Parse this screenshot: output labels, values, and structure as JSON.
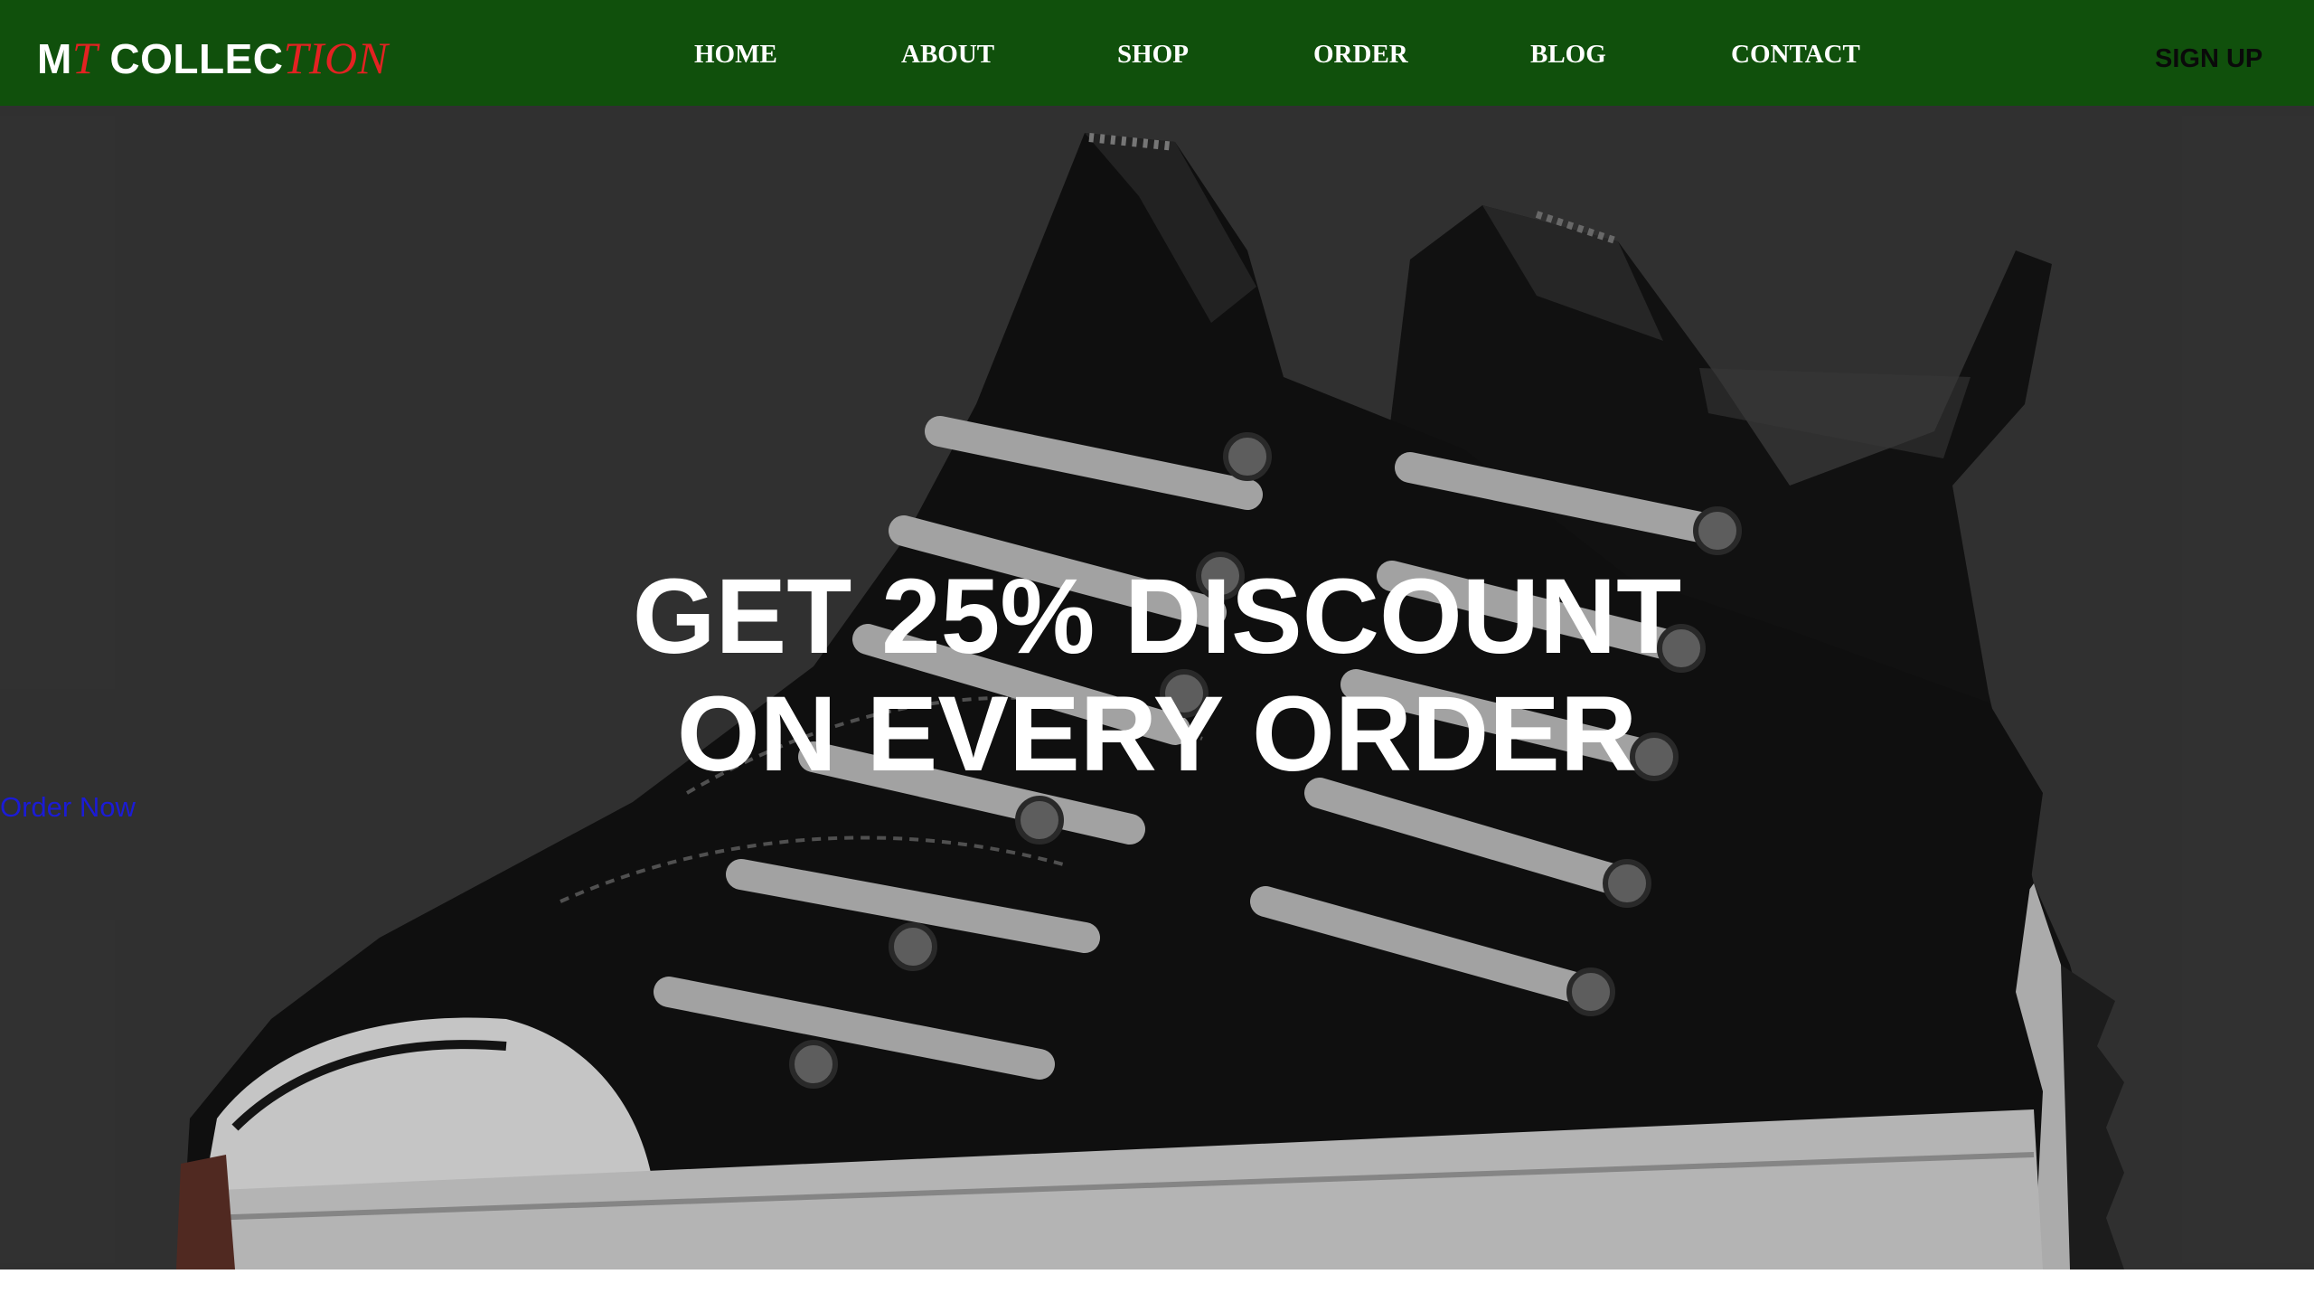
{
  "logo": {
    "part1": "M",
    "part2": "T",
    "part3": " COLLEC",
    "part4": "TION"
  },
  "nav": {
    "items": [
      {
        "label": "HOME"
      },
      {
        "label": "ABOUT"
      },
      {
        "label": "SHOP"
      },
      {
        "label": "ORDER"
      },
      {
        "label": "BLOG"
      },
      {
        "label": "CONTACT"
      }
    ],
    "signup_label": "SIGN UP"
  },
  "hero": {
    "headline_line1": "GET 25% DISCOUNT",
    "headline_line2": "ON EVERY ORDER",
    "cta_label": "Order Now",
    "image_subject": "black-high-top-sneakers"
  },
  "colors": {
    "nav_background": "#10500c",
    "logo_accent": "#e32222",
    "hero_background": "#333333",
    "cta_link": "#1b1bd6"
  }
}
